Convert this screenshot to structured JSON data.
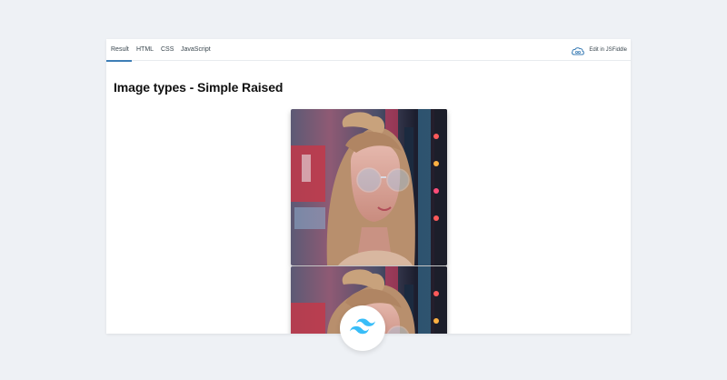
{
  "tabs": {
    "result": "Result",
    "html": "HTML",
    "css": "CSS",
    "javascript": "JavaScript"
  },
  "edit_link": {
    "label": "Edit in JSFiddle",
    "icon": "cloud-icon"
  },
  "content": {
    "title": "Image types - Simple Raised"
  },
  "images": [
    {
      "name": "woman-with-glasses-photo",
      "alt": "portrait"
    },
    {
      "name": "woman-with-glasses-photo",
      "alt": "portrait"
    }
  ],
  "badge": {
    "icon": "tailwind-logo-icon"
  },
  "colors": {
    "background": "#eef1f5",
    "accent": "#3d7eb6",
    "tailwind": "#38bdf8"
  }
}
